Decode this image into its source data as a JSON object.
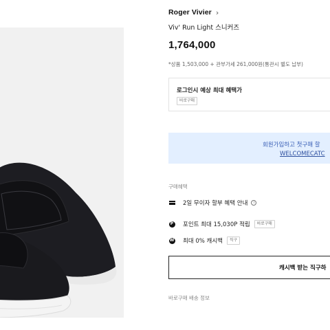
{
  "product": {
    "brand": "Roger Vivier",
    "name": "Viv' Run Light 스니커즈",
    "price": "1,764,000",
    "price_note": "*상품 1,503,000 + 관부가세 261,000원(통관시 별도 납부)"
  },
  "benefit_box": {
    "title": "로그인시 예상 최대 혜택가",
    "tag": "바로구매"
  },
  "banner": {
    "line1": "회원가입하고 첫구매 할",
    "line2": "WELCOMECATC"
  },
  "purchase_benefits": {
    "label": "구매혜택",
    "items": [
      {
        "icon": "card-icon",
        "text": "2일 무이자 할부 혜택 안내"
      },
      {
        "icon": "point-icon",
        "icon_glyph": "P",
        "text": "포인트 최대 15,030P 적립",
        "tag": "바로구매"
      },
      {
        "icon": "cashback-icon",
        "icon_glyph": "W",
        "text": "최대 0% 캐시백",
        "tag": "직구"
      }
    ]
  },
  "cashback_button": {
    "label": "캐시백 받는 직구하"
  },
  "shipping": {
    "label": "바로구매 배송 정보"
  },
  "colors": {
    "banner_bg": "#e3efff",
    "banner_text": "#3a5fb5",
    "gallery_bg": "#f1f1f1",
    "shoe": "#1b1b1f",
    "sole": "#f2f2f2"
  }
}
